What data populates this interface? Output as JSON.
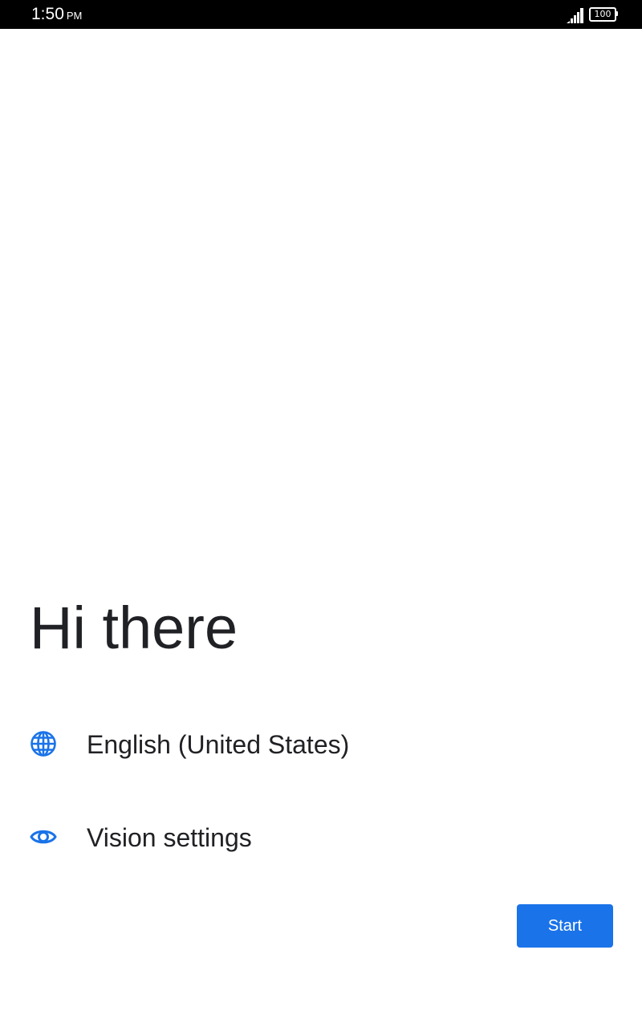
{
  "status_bar": {
    "time": "1:50",
    "ampm": "PM",
    "battery_level": "100",
    "icons": [
      "signal-icon",
      "battery-icon"
    ]
  },
  "main": {
    "title": "Hi there",
    "options": [
      {
        "label": "English (United States)",
        "icon": "globe-icon"
      },
      {
        "label": "Vision settings",
        "icon": "eye-icon"
      }
    ],
    "start_label": "Start"
  },
  "colors": {
    "accent": "#1a73e8",
    "text": "#202124",
    "status_bar_bg": "#000000",
    "background": "#ffffff"
  }
}
